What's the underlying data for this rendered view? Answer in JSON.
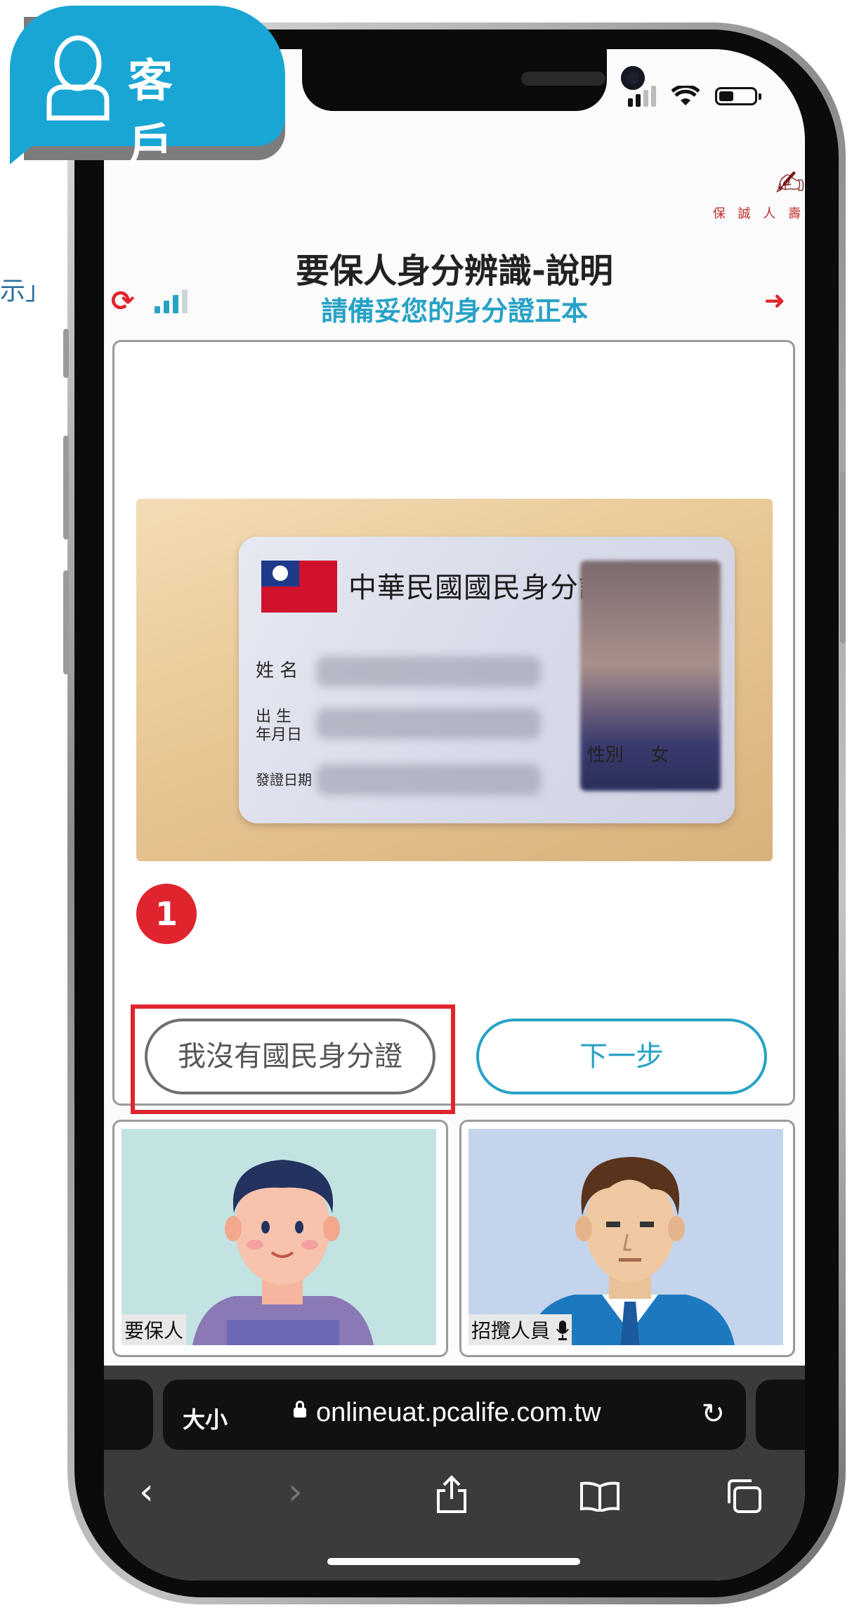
{
  "side_note": "示」",
  "customer_badge": {
    "label": "客 戶",
    "icon": "person-outline-icon"
  },
  "status_bar": {
    "icons": [
      "cellular-signal-icon",
      "wifi-icon",
      "battery-icon"
    ]
  },
  "brand": {
    "logo_text": "保 誠 人 壽",
    "logo_icon": "prudential-logo-icon"
  },
  "header": {
    "title": "要保人身分辨識-說明",
    "subtitle": "請備妥您的身分證正本",
    "refresh_icon": "refresh-icon",
    "connection_icon": "connection-strength-icon",
    "logout_icon": "logout-icon"
  },
  "id_card": {
    "title": "中華民國國民身分證",
    "name_label": "姓 名",
    "birth_label_1": "出 生",
    "birth_label_2": "年月日",
    "issue_label": "發證日期",
    "gender_label": "性別",
    "gender_value": "女"
  },
  "step_badge": "1",
  "buttons": {
    "no_id": "我沒有國民身分證",
    "next": "下一步"
  },
  "video": {
    "policyholder_label": "要保人",
    "agent_label": "招攬人員",
    "mic_icon": "microphone-icon"
  },
  "browser": {
    "text_size": "大小",
    "url": "onlineuat.pcalife.com.tw",
    "lock_icon": "lock-icon",
    "reload_icon": "reload-icon",
    "nav_icons": [
      "back-icon",
      "forward-icon",
      "share-icon",
      "bookmarks-icon",
      "tabs-icon"
    ]
  },
  "colors": {
    "accent": "#27a2c6",
    "alert": "#e0242e",
    "badge": "#19a6d4"
  }
}
